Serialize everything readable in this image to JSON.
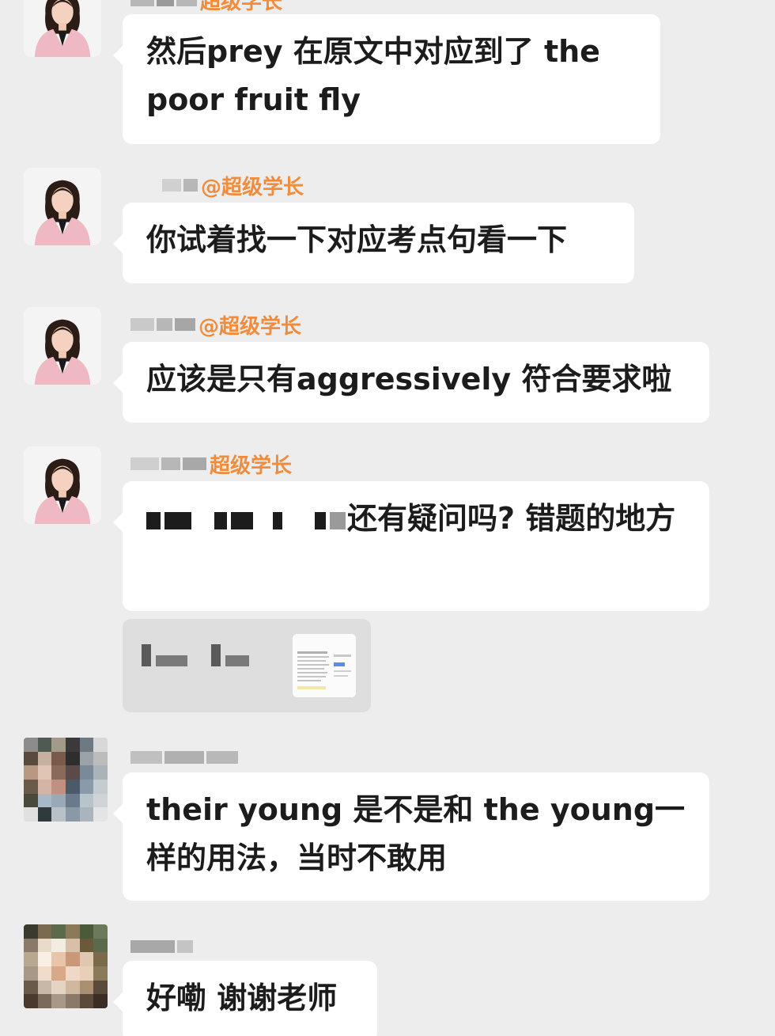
{
  "chat": {
    "messages": [
      {
        "sender": "超级学长",
        "text": "然后prey 在原文中对应到了 the poor fruit fly"
      },
      {
        "sender": "@超级学长",
        "text": "你试着找一下对应考点句看一下"
      },
      {
        "sender": "@超级学长",
        "text": "应该是只有aggressively 符合要求啦"
      },
      {
        "sender": "超级学长",
        "text": "还有疑问吗? 错题的地方"
      },
      {
        "text": "their young 是不是和 the young一样的用法，当时不敢用"
      },
      {
        "text": "好嘞 谢谢老师"
      }
    ]
  },
  "colors": {
    "background": "#ededed",
    "bubble": "#ffffff",
    "sender_name": "#f08c3c",
    "text": "#1c1c1c"
  },
  "icons": {
    "teacher_avatar": "woman-in-pink-blazer-avatar",
    "student_avatar": "pixelated-avatar",
    "attachment": "document-thumbnail"
  }
}
